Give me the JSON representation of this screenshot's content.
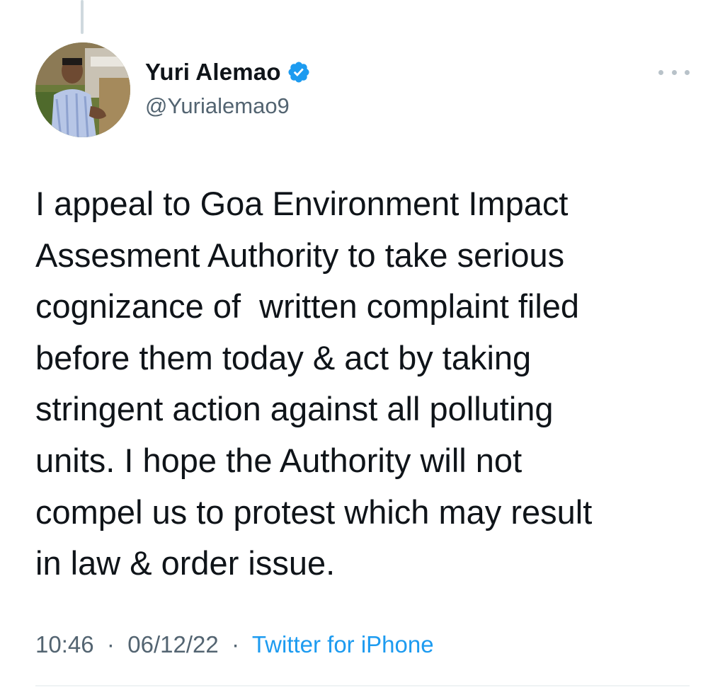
{
  "tweet": {
    "author": {
      "display_name": "Yuri Alemao",
      "handle": "@Yurialemao9",
      "verified": true,
      "avatar_icon": "profile-photo"
    },
    "text": "I appeal to Goa Environment Impact\nAssesment Authority to take serious\ncognizance of  written complaint filed\nbefore them today & act by taking\nstringent action against all polluting\nunits. I hope the Authority will not\ncompel us to protest which may result\nin law & order issue.",
    "time": "10:46",
    "date": "06/12/22",
    "separator": "·",
    "source": "Twitter for iPhone",
    "more_icon": "more-horizontal-icon"
  },
  "colors": {
    "text_primary": "#0f1419",
    "text_secondary": "#536471",
    "accent": "#1d9bf0",
    "verified_badge": "#1d9bf0",
    "thread_line": "#cfd9de"
  }
}
